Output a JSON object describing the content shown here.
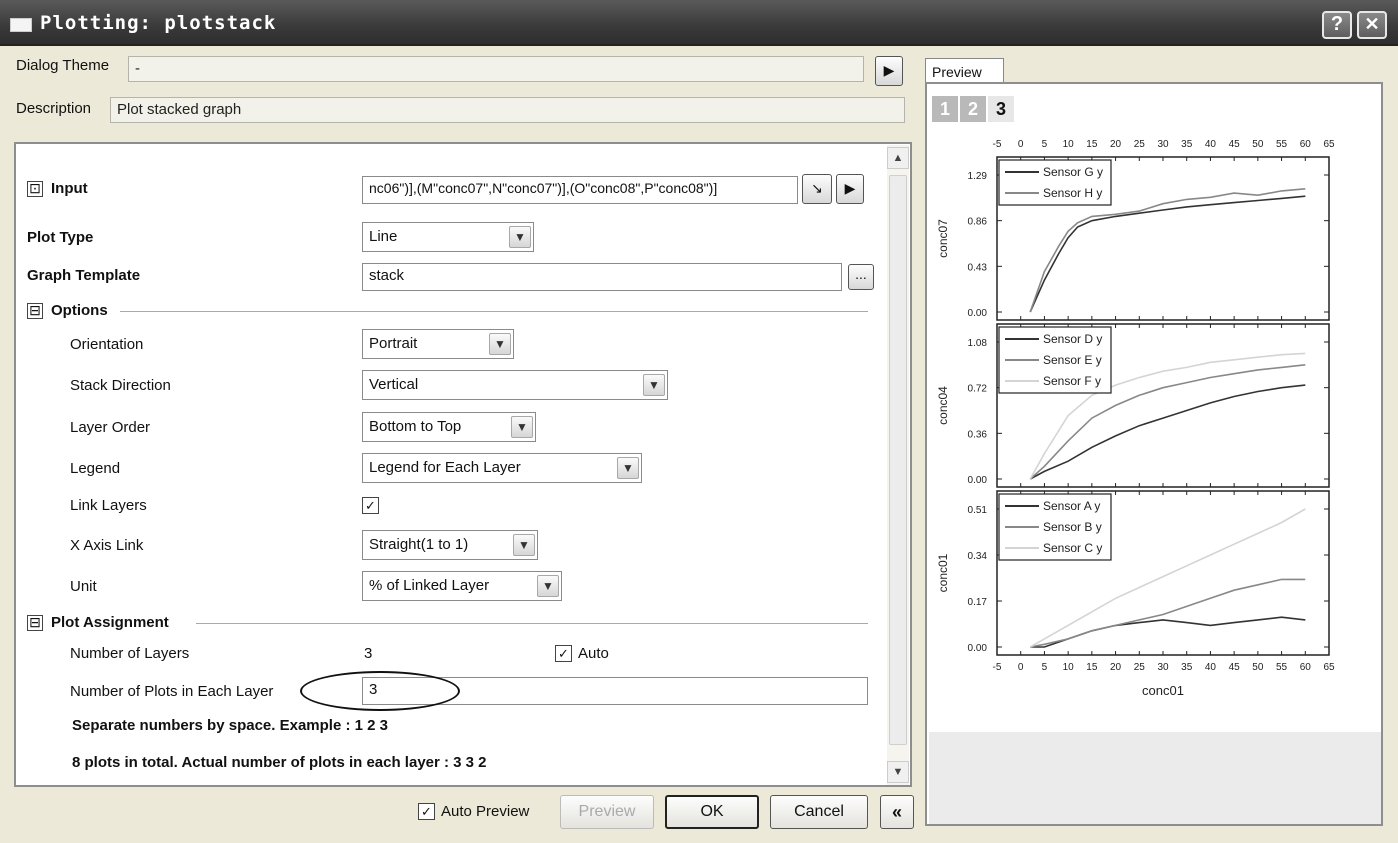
{
  "window": {
    "title": "Plotting: plotstack",
    "help_label": "?",
    "close_label": "✕"
  },
  "header": {
    "dialog_theme_label": "Dialog Theme",
    "dialog_theme_value": "-",
    "description_label": "Description",
    "description_value": "Plot stacked graph"
  },
  "form": {
    "input_toggle": "⊡",
    "input_label": "Input",
    "input_value": "nc06\")],(M\"conc07\",N\"conc07\")],(O\"conc08\",P\"conc08\")]",
    "plot_type_label": "Plot Type",
    "plot_type_value": "Line",
    "graph_template_label": "Graph Template",
    "graph_template_value": "stack",
    "browse_label": "...",
    "options": {
      "toggle": "⊟",
      "title": "Options",
      "orientation_label": "Orientation",
      "orientation_value": "Portrait",
      "stack_direction_label": "Stack Direction",
      "stack_direction_value": "Vertical",
      "layer_order_label": "Layer Order",
      "layer_order_value": "Bottom to Top",
      "legend_label": "Legend",
      "legend_value": "Legend for Each Layer",
      "link_layers_label": "Link Layers",
      "link_layers_checked": "✓",
      "x_axis_link_label": "X Axis Link",
      "x_axis_link_value": "Straight(1 to 1)",
      "unit_label": "Unit",
      "unit_value": "% of Linked Layer"
    },
    "plot_assignment": {
      "toggle": "⊟",
      "title": "Plot Assignment",
      "num_layers_label": "Number of Layers",
      "num_layers_value": "3",
      "auto_checked": "✓",
      "auto_label": "Auto",
      "plots_each_layer_label": "Number of Plots in Each Layer",
      "plots_each_layer_value": "3",
      "hint": "Separate numbers by space. Example : 1 2 3",
      "summary": "8 plots in total. Actual number of plots in each layer : 3 3 2"
    }
  },
  "footer": {
    "auto_preview_checked": "✓",
    "auto_preview_label": "Auto Preview",
    "preview_button": "Preview",
    "ok_button": "OK",
    "cancel_button": "Cancel",
    "collapse_button": "«"
  },
  "preview": {
    "tab_label": "Preview",
    "layer_tabs": [
      "1",
      "2",
      "3"
    ],
    "colors": {
      "dark": "#333333",
      "mid": "#888888",
      "light": "#d4d4d4"
    },
    "chart_data": {
      "type": "line",
      "xlabel": "conc01",
      "x_ticks": [
        "-5",
        "0",
        "5",
        "10",
        "15",
        "20",
        "25",
        "30",
        "35",
        "40",
        "45",
        "50",
        "55",
        "60",
        "65"
      ],
      "xlim": [
        -5,
        65
      ],
      "layers": [
        {
          "ylabel": "conc07",
          "ylim": [
            0,
            1.29
          ],
          "y_ticks": [
            "1.29",
            "0.86",
            "0.43",
            "0.00"
          ],
          "series": [
            {
              "name": "Sensor G  y",
              "color": "dark",
              "x": [
                2,
                5,
                8,
                10,
                12,
                15,
                20,
                25,
                30,
                35,
                40,
                45,
                50,
                55,
                60
              ],
              "y": [
                0.0,
                0.3,
                0.55,
                0.7,
                0.8,
                0.86,
                0.9,
                0.93,
                0.96,
                0.99,
                1.01,
                1.03,
                1.05,
                1.07,
                1.09
              ]
            },
            {
              "name": "Sensor H  y",
              "color": "mid",
              "x": [
                2,
                5,
                8,
                10,
                12,
                15,
                20,
                25,
                30,
                35,
                40,
                45,
                50,
                55,
                60
              ],
              "y": [
                0.0,
                0.38,
                0.62,
                0.76,
                0.84,
                0.9,
                0.92,
                0.95,
                1.02,
                1.06,
                1.08,
                1.12,
                1.1,
                1.14,
                1.16
              ]
            }
          ]
        },
        {
          "ylabel": "conc04",
          "ylim": [
            0,
            1.08
          ],
          "y_ticks": [
            "1.08",
            "0.72",
            "0.36",
            "0.00"
          ],
          "series": [
            {
              "name": "Sensor D  y",
              "color": "dark",
              "x": [
                2,
                5,
                10,
                15,
                20,
                25,
                30,
                35,
                40,
                45,
                50,
                55,
                60
              ],
              "y": [
                0.0,
                0.06,
                0.14,
                0.25,
                0.34,
                0.42,
                0.48,
                0.54,
                0.6,
                0.65,
                0.69,
                0.72,
                0.74
              ]
            },
            {
              "name": "Sensor E  y",
              "color": "mid",
              "x": [
                2,
                5,
                10,
                15,
                20,
                25,
                30,
                35,
                40,
                45,
                50,
                55,
                60
              ],
              "y": [
                0.0,
                0.1,
                0.3,
                0.48,
                0.58,
                0.66,
                0.72,
                0.76,
                0.8,
                0.83,
                0.86,
                0.88,
                0.9
              ]
            },
            {
              "name": "Sensor F  y",
              "color": "light",
              "x": [
                2,
                5,
                10,
                15,
                20,
                25,
                30,
                35,
                40,
                45,
                50,
                55,
                60
              ],
              "y": [
                0.0,
                0.2,
                0.5,
                0.66,
                0.74,
                0.8,
                0.85,
                0.88,
                0.92,
                0.94,
                0.96,
                0.98,
                0.99
              ]
            }
          ]
        },
        {
          "ylabel": "conc01",
          "ylim": [
            0,
            0.51
          ],
          "y_ticks": [
            "0.51",
            "0.34",
            "0.17",
            "0.00"
          ],
          "series": [
            {
              "name": "Sensor A  y",
              "color": "dark",
              "x": [
                2,
                5,
                10,
                15,
                20,
                25,
                30,
                35,
                40,
                45,
                50,
                55,
                60
              ],
              "y": [
                0.0,
                0.0,
                0.03,
                0.06,
                0.08,
                0.09,
                0.1,
                0.09,
                0.08,
                0.09,
                0.1,
                0.11,
                0.1
              ]
            },
            {
              "name": "Sensor B  y",
              "color": "mid",
              "x": [
                2,
                5,
                10,
                15,
                20,
                25,
                30,
                35,
                40,
                45,
                50,
                55,
                60
              ],
              "y": [
                0.0,
                0.01,
                0.03,
                0.06,
                0.08,
                0.1,
                0.12,
                0.15,
                0.18,
                0.21,
                0.23,
                0.25,
                0.25
              ]
            },
            {
              "name": "Sensor C  y",
              "color": "light",
              "x": [
                2,
                5,
                10,
                15,
                20,
                25,
                30,
                35,
                40,
                45,
                50,
                55,
                60
              ],
              "y": [
                0.0,
                0.03,
                0.08,
                0.13,
                0.18,
                0.22,
                0.26,
                0.3,
                0.34,
                0.38,
                0.42,
                0.46,
                0.51
              ]
            }
          ]
        }
      ]
    }
  }
}
